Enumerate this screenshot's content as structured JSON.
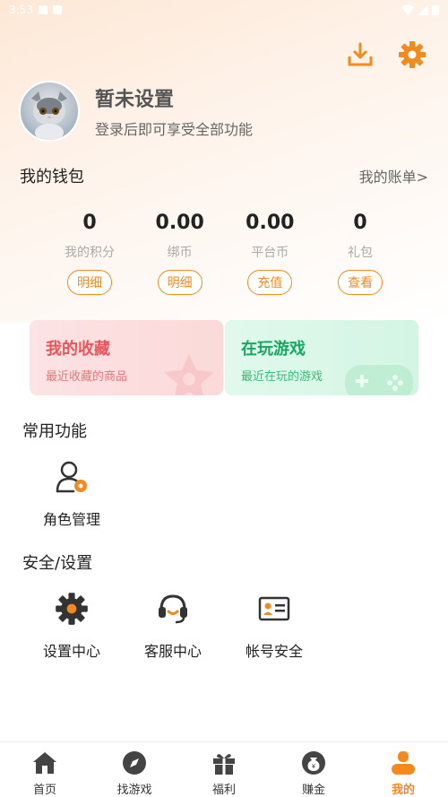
{
  "status_bar": {
    "time": "3:53"
  },
  "profile": {
    "name": "暂未设置",
    "subtitle": "登录后即可享受全部功能"
  },
  "wallet": {
    "title": "我的钱包",
    "bill_link": "我的账单>",
    "items": [
      {
        "value": "0",
        "label": "我的积分",
        "button": "明细"
      },
      {
        "value": "0.00",
        "label": "绑币",
        "button": "明细"
      },
      {
        "value": "0.00",
        "label": "平台币",
        "button": "充值"
      },
      {
        "value": "0",
        "label": "礼包",
        "button": "查看"
      }
    ]
  },
  "cards": {
    "favorites": {
      "title": "我的收藏",
      "subtitle": "最近收藏的商品"
    },
    "playing": {
      "title": "在玩游戏",
      "subtitle": "最近在玩的游戏"
    }
  },
  "common": {
    "title": "常用功能",
    "items": [
      {
        "label": "角色管理",
        "icon": "role-manage-icon"
      }
    ]
  },
  "security": {
    "title": "安全/设置",
    "items": [
      {
        "label": "设置中心",
        "icon": "gear-icon"
      },
      {
        "label": "客服中心",
        "icon": "headset-icon"
      },
      {
        "label": "帐号安全",
        "icon": "id-card-icon"
      }
    ]
  },
  "tabs": [
    {
      "label": "首页",
      "icon": "home-icon"
    },
    {
      "label": "找游戏",
      "icon": "compass-icon"
    },
    {
      "label": "福利",
      "icon": "gift-icon"
    },
    {
      "label": "赚金",
      "icon": "money-bag-icon"
    },
    {
      "label": "我的",
      "icon": "user-icon",
      "active": true
    }
  ],
  "colors": {
    "accent": "#f38a1e",
    "fav": "#e8555a",
    "play": "#19a862",
    "icon_dark": "#333333"
  }
}
